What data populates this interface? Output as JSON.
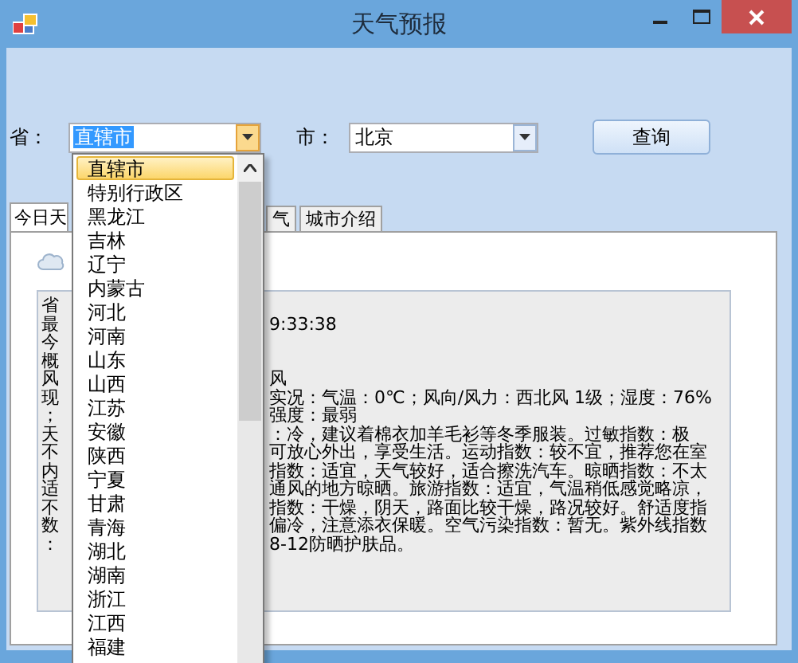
{
  "window": {
    "title": "天气预报"
  },
  "province": {
    "label": "省：",
    "value": "直辖市",
    "focused": true,
    "open": true
  },
  "city": {
    "label": "市：",
    "value": "北京"
  },
  "query_button": "查询",
  "tabs": [
    {
      "label": "今日天",
      "selected": true
    },
    {
      "label": "气",
      "selected": false
    },
    {
      "label": "城市介绍",
      "selected": false
    }
  ],
  "report_lines": [
    {
      "left": "省"
    },
    {
      "left": "最",
      "right": "9:33:38"
    },
    {
      "left": "今"
    },
    {
      "left": "概"
    },
    {
      "left": "风",
      "right": "风"
    },
    {
      "left": "现",
      "right": "实况：气温：0℃；风向/风力：西北风 1级；湿度：76%"
    },
    {
      "left": "；",
      "right": "强度：最弱"
    },
    {
      "left": "天",
      "right": "：冷，建议着棉衣加羊毛衫等冬季服装。过敏指数：极"
    },
    {
      "left": "不",
      "right": "可放心外出，享受生活。运动指数：较不宜，推荐您在室"
    },
    {
      "left": "内",
      "right": "指数：适宜，天气较好，适合擦洗汽车。晾晒指数：不太"
    },
    {
      "left": "适",
      "right": "通风的地方晾晒。旅游指数：适宜，气温稍低感觉略凉，"
    },
    {
      "left": "不",
      "right": "指数：干燥，阴天，路面比较干燥，路况较好。舒适度指"
    },
    {
      "left": "数",
      "right": "偏冷，注意添衣保暖。空气污染指数：暂无。紫外线指数"
    },
    {
      "left": "：",
      "right": "8-12防晒护肤品。"
    }
  ],
  "province_options": [
    {
      "label": "直辖市",
      "selected": true
    },
    {
      "label": "特别行政区",
      "selected": false
    },
    {
      "label": "黑龙江",
      "selected": false
    },
    {
      "label": "吉林",
      "selected": false
    },
    {
      "label": "辽宁",
      "selected": false
    },
    {
      "label": "内蒙古",
      "selected": false
    },
    {
      "label": "河北",
      "selected": false
    },
    {
      "label": "河南",
      "selected": false
    },
    {
      "label": "山东",
      "selected": false
    },
    {
      "label": "山西",
      "selected": false
    },
    {
      "label": "江苏",
      "selected": false
    },
    {
      "label": "安徽",
      "selected": false
    },
    {
      "label": "陕西",
      "selected": false
    },
    {
      "label": "宁夏",
      "selected": false
    },
    {
      "label": "甘肃",
      "selected": false
    },
    {
      "label": "青海",
      "selected": false
    },
    {
      "label": "湖北",
      "selected": false
    },
    {
      "label": "湖南",
      "selected": false
    },
    {
      "label": "浙江",
      "selected": false
    },
    {
      "label": "江西",
      "selected": false
    },
    {
      "label": "福建",
      "selected": false
    }
  ]
}
